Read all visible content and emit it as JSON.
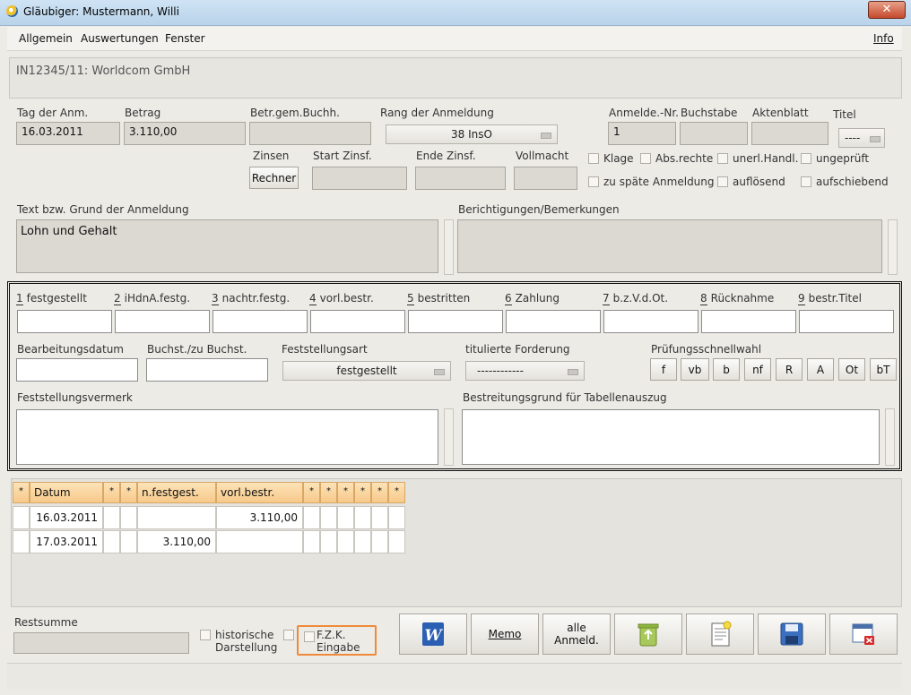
{
  "window": {
    "title": "Gläubiger: Mustermann, Willi",
    "close": "✕"
  },
  "menu": {
    "items": [
      "Allgemein",
      "Auswertungen",
      "Fenster"
    ],
    "info": "Info"
  },
  "case": {
    "title": "IN12345/11: Worldcom GmbH"
  },
  "claim": {
    "tag_label": "Tag der Anm.",
    "tag_value": "16.03.2011",
    "betrag_label": "Betrag",
    "betrag_value": "3.110,00",
    "betr_gem_label": "Betr.gem.Buchh.",
    "rang_label": "Rang der Anmeldung",
    "rang_value": "38 InsO",
    "anmelde_nr_label": "Anmelde.-Nr.",
    "anmelde_nr_value": "1",
    "buchstabe_label": "Buchstabe",
    "aktenblatt_label": "Aktenblatt",
    "titel_label": "Titel",
    "titel_value": "----",
    "zinsen_label": "Zinsen",
    "rechner_label": "Rechner",
    "start_zinsf_label": "Start Zinsf.",
    "ende_zinsf_label": "Ende Zinsf.",
    "vollmacht_label": "Vollmacht",
    "checks_row1": [
      "Klage",
      "Abs.rechte",
      "unerl.Handl.",
      "ungeprüft"
    ],
    "checks_row2": [
      "zu späte Anmeldung",
      "auflösend",
      "aufschiebend"
    ],
    "text_label": "Text bzw. Grund der Anmeldung",
    "text_value": "Lohn und Gehalt",
    "berichtigungen_label": "Berichtigungen/Bemerkungen"
  },
  "status_fields": [
    {
      "num": "1",
      "label": "festgestellt"
    },
    {
      "num": "2",
      "label": "iHdnA.festg."
    },
    {
      "num": "3",
      "label": "nachtr.festg."
    },
    {
      "num": "4",
      "label": "vorl.bestr."
    },
    {
      "num": "5",
      "label": "bestritten"
    },
    {
      "num": "6",
      "label": "Zahlung"
    },
    {
      "num": "7",
      "label": "b.z.V.d.Ot."
    },
    {
      "num": "8",
      "label": "Rücknahme"
    },
    {
      "num": "9",
      "label": "bestr.Titel"
    }
  ],
  "processing": {
    "bearb_datum_label": "Bearbeitungsdatum",
    "buchst_label": "Buchst./zu Buchst.",
    "feststellungsart_label": "Feststellungsart",
    "feststellungsart_value": "festgestellt",
    "titulierte_label": "titulierte Forderung",
    "titulierte_value": "------------",
    "pruefung_label": "Prüfungsschnellwahl",
    "quick_buttons": [
      "f",
      "vb",
      "b",
      "nf",
      "R",
      "A",
      "Ot",
      "bT"
    ],
    "vermerk_label": "Feststellungsvermerk",
    "bestreitung_label": "Bestreitungsgrund für Tabellenauszug"
  },
  "table": {
    "headers": [
      "*",
      "Datum",
      "*",
      "*",
      "n.festgest.",
      "vorl.bestr.",
      "*",
      "*",
      "*",
      "*",
      "*",
      "*"
    ],
    "rows": [
      {
        "datum": "16.03.2011",
        "nfestgest": "",
        "vorlbestr": "3.110,00"
      },
      {
        "datum": "17.03.2011",
        "nfestgest": "3.110,00",
        "vorlbestr": ""
      }
    ]
  },
  "footer": {
    "restsumme_label": "Restsumme",
    "historische_label": "historische",
    "darstellung_label": "Darstellung",
    "fzk_label": "F.Z.K.",
    "eingabe_label": "Eingabe",
    "memo_label": "Memo",
    "alle_label_1": "alle",
    "alle_label_2": "Anmeld."
  },
  "colors": {
    "accent_orange": "#f08a3a",
    "word_blue": "#2b5fb3"
  }
}
